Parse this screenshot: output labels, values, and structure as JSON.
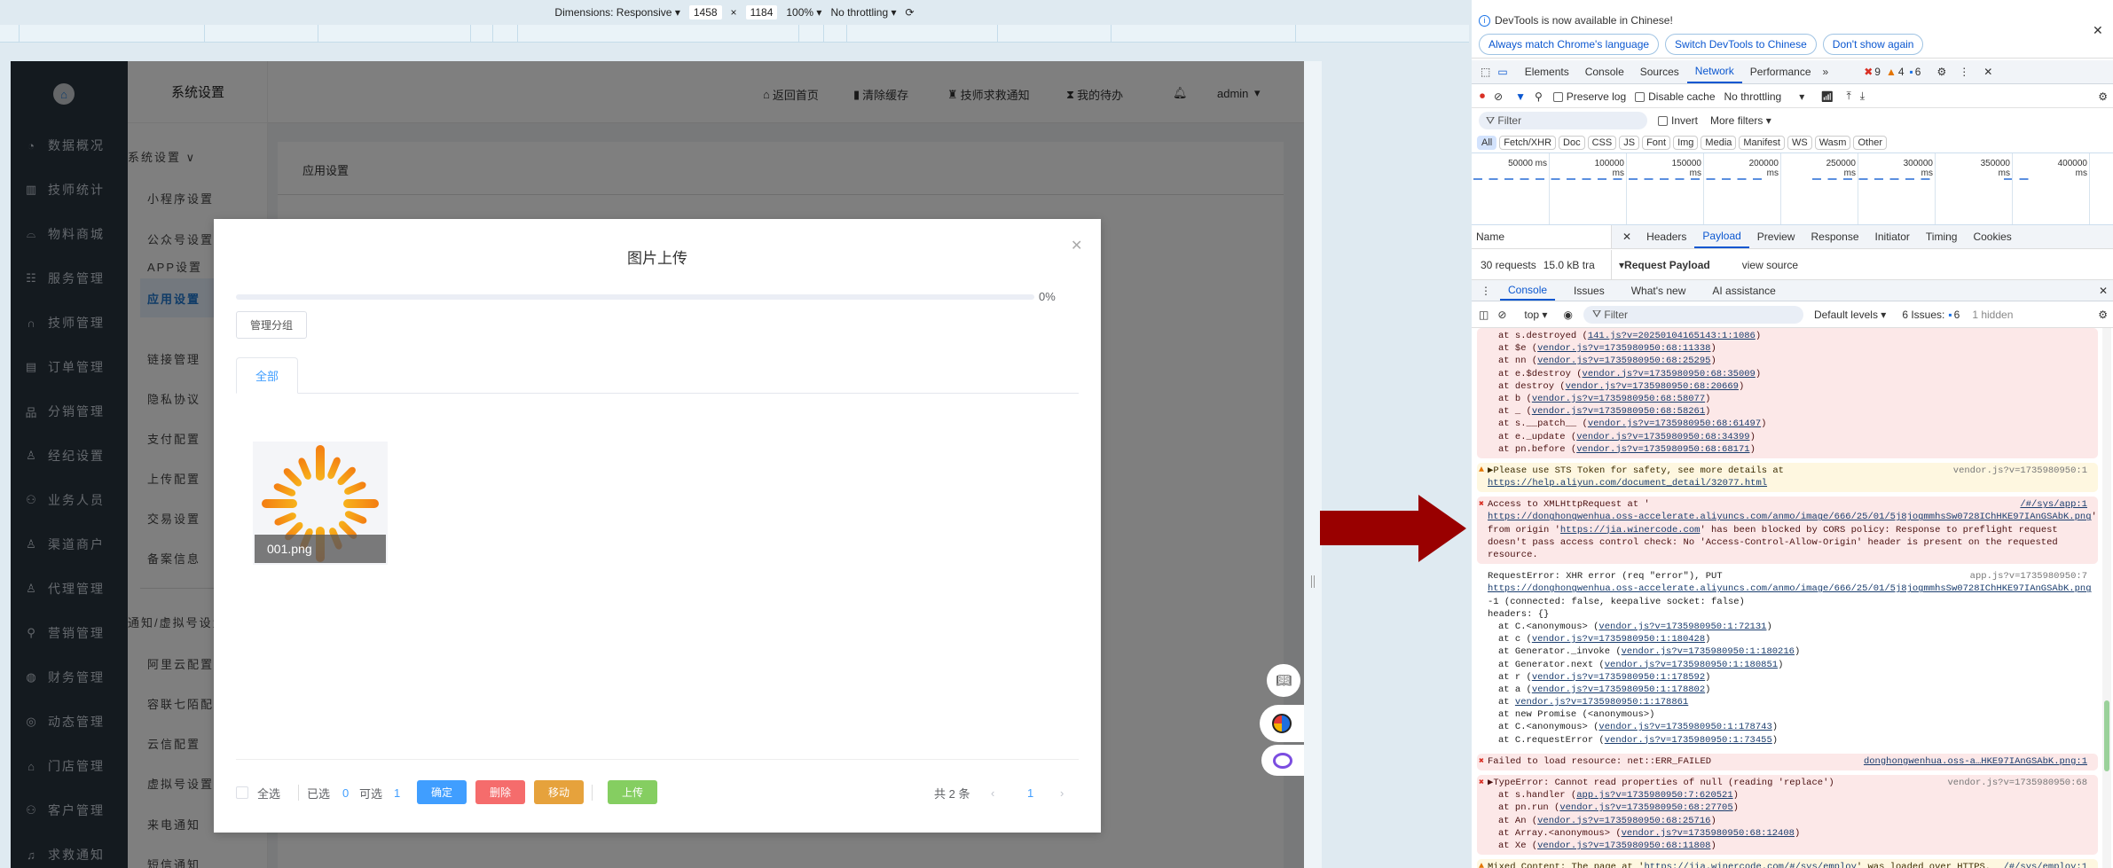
{
  "device_toolbar": {
    "dimensions": "Dimensions: Responsive ▾",
    "width": "1458",
    "x": "×",
    "height": "1184",
    "zoom": "100% ▾",
    "throttle": "No throttling ▾"
  },
  "app": {
    "sidebar": [
      {
        "label": "数据概况",
        "icon": "pie-chart-icon"
      },
      {
        "label": "技师统计",
        "icon": "bar-chart-icon"
      },
      {
        "label": "物料商城",
        "icon": "shop-bag-icon"
      },
      {
        "label": "服务管理",
        "icon": "service-icon"
      },
      {
        "label": "技师管理",
        "icon": "headset-icon"
      },
      {
        "label": "订单管理",
        "icon": "clipboard-icon"
      },
      {
        "label": "分销管理",
        "icon": "org-chart-icon"
      },
      {
        "label": "经纪设置",
        "icon": "user-icon"
      },
      {
        "label": "业务人员",
        "icon": "users-icon"
      },
      {
        "label": "渠道商户",
        "icon": "user-icon"
      },
      {
        "label": "代理管理",
        "icon": "agent-icon"
      },
      {
        "label": "营销管理",
        "icon": "marketing-icon"
      },
      {
        "label": "财务管理",
        "icon": "wallet-icon"
      },
      {
        "label": "动态管理",
        "icon": "compass-icon"
      },
      {
        "label": "门店管理",
        "icon": "store-icon"
      },
      {
        "label": "客户管理",
        "icon": "customers-icon"
      },
      {
        "label": "求救通知",
        "icon": "bell-icon"
      }
    ],
    "submenu_title": "系统设置",
    "submenu": [
      {
        "label": "系统设置 ∨",
        "group": true
      },
      {
        "label": "小程序设置"
      },
      {
        "label": "公众号设置"
      },
      {
        "label": "APP设置"
      },
      {
        "label": "应用设置",
        "active": true
      },
      {
        "label": "链接管理"
      },
      {
        "label": "隐私协议"
      },
      {
        "label": "支付配置"
      },
      {
        "label": "上传配置"
      },
      {
        "label": "交易设置"
      },
      {
        "label": "备案信息"
      },
      {
        "label": "通知/虚拟号设置",
        "group": true
      },
      {
        "label": "阿里云配置"
      },
      {
        "label": "容联七陌配置"
      },
      {
        "label": "云信配置"
      },
      {
        "label": "虚拟号设置"
      },
      {
        "label": "来电通知"
      },
      {
        "label": "短信通知"
      }
    ],
    "header": {
      "home": "返回首页",
      "clear_cache": "清除缓存",
      "sos": "技师求救通知",
      "todo": "我的待办",
      "user": "admin"
    },
    "card_title": "应用设置"
  },
  "modal": {
    "title": "图片上传",
    "progress_percent": 0,
    "progress_label": "0%",
    "manage_group": "管理分组",
    "tab_all": "全部",
    "image_name": "001.png",
    "footer": {
      "select_all": "全选",
      "selected_label": "已选",
      "selected": "0",
      "selectable_label": "可选",
      "selectable": "1",
      "confirm": "确定",
      "delete": "删除",
      "move": "移动",
      "upload": "上传",
      "total": "共 2 条",
      "page": "1"
    },
    "colors": {
      "confirm": "#409eff",
      "delete": "#f56c6c",
      "move": "#e6a23c",
      "upload": "#85ce61"
    }
  },
  "devtools": {
    "banner": {
      "message": "DevTools is now available in Chinese!",
      "btn1": "Always match Chrome's language",
      "btn2": "Switch DevTools to Chinese",
      "btn3": "Don't show again"
    },
    "tabs": [
      "Elements",
      "Console",
      "Sources",
      "Network",
      "Performance"
    ],
    "active_tab": "Network",
    "counts": {
      "errors": "9",
      "warnings": "4",
      "info": "6"
    },
    "network_toolbar": {
      "preserve_log": "Preserve log",
      "disable_cache": "Disable cache",
      "throttle": "No throttling"
    },
    "filter": {
      "placeholder": "Filter",
      "invert": "Invert",
      "more": "More filters ▾"
    },
    "type_filters": [
      "All",
      "Fetch/XHR",
      "Doc",
      "CSS",
      "JS",
      "Font",
      "Img",
      "Media",
      "Manifest",
      "WS",
      "Wasm",
      "Other"
    ],
    "timeline_ticks": [
      "50000 ms",
      "100000 ms",
      "150000 ms",
      "200000 ms",
      "250000 ms",
      "300000 ms",
      "350000 ms",
      "400000 ms"
    ],
    "name_header": "Name",
    "requests": "30 requests",
    "transferred": "15.0 kB tra",
    "detail_tabs": [
      "Headers",
      "Payload",
      "Preview",
      "Response",
      "Initiator",
      "Timing",
      "Cookies"
    ],
    "active_detail": "Payload",
    "payload_title": "▾Request Payload",
    "view_source": "view source",
    "drawer_tabs": [
      "Console",
      "Issues",
      "What's new",
      "AI assistance"
    ],
    "console_toolbar": {
      "context": "top ▾",
      "filter": "Filter",
      "levels": "Default levels ▾",
      "issues": "6 Issues:",
      "issues_count": "6",
      "hidden": "1 hidden"
    },
    "entries": [
      {
        "level": "error",
        "lines": [
          {
            "at": true,
            "t": "at s.destroyed (",
            "l": "141.js?v=20250104165143:1:1086",
            "e": ")"
          },
          {
            "at": true,
            "t": "at $e (",
            "l": "vendor.js?v=1735980950:68:11338",
            "e": ")"
          },
          {
            "at": true,
            "t": "at nn (",
            "l": "vendor.js?v=1735980950:68:25295",
            "e": ")"
          },
          {
            "at": true,
            "t": "at e.$destroy (",
            "l": "vendor.js?v=1735980950:68:35009",
            "e": ")"
          },
          {
            "at": true,
            "t": "at destroy (",
            "l": "vendor.js?v=1735980950:68:20669",
            "e": ")"
          },
          {
            "at": true,
            "t": "at b (",
            "l": "vendor.js?v=1735980950:68:58077",
            "e": ")"
          },
          {
            "at": true,
            "t": "at _ (",
            "l": "vendor.js?v=1735980950:68:58261",
            "e": ")"
          },
          {
            "at": true,
            "t": "at s.__patch__ (",
            "l": "vendor.js?v=1735980950:68:61497",
            "e": ")"
          },
          {
            "at": true,
            "t": "at e._update (",
            "l": "vendor.js?v=1735980950:68:34399",
            "e": ")"
          },
          {
            "at": true,
            "t": "at pn.before (",
            "l": "vendor.js?v=1735980950:68:68171",
            "e": ")"
          }
        ]
      },
      {
        "level": "warn",
        "icon": "▲",
        "src": "vendor.js?v=1735980950:1",
        "lines": [
          {
            "t": "▶Please use STS Token for safety, see more details at"
          },
          {
            "l": "https://help.aliyun.com/document_detail/32077.html"
          }
        ]
      },
      {
        "level": "error",
        "icon": "✖",
        "src": "/#/sys/app:1",
        "src_link": true,
        "lines": [
          {
            "t": "Access to XMLHttpRequest at '"
          },
          {
            "l": "https://donghongwenhua.oss-accelerate.aliyuncs.com/anmo/image/666/25/01/5j8jogmmhsSw0728IChHKE97IAnGSAbK.png",
            "e": "'"
          },
          {
            "t": "from origin '",
            "l": "https://jia.winercode.com",
            "e": "' has been blocked by CORS policy: Response to preflight request"
          },
          {
            "t": "doesn't pass access control check: No 'Access-Control-Allow-Origin' header is present on the requested"
          },
          {
            "t": "resource."
          }
        ]
      },
      {
        "level": "info",
        "src": "app.js?v=1735980950:7",
        "lines": [
          {
            "t": "RequestError: XHR error (req \"error\"), PUT"
          },
          {
            "l": "https://donghongwenhua.oss-accelerate.aliyuncs.com/anmo/image/666/25/01/5j8jogmmhsSw0728IChHKE97IAnGSAbK.png"
          },
          {
            "t": "-1 (connected: false, keepalive socket: false)"
          },
          {
            "t": "headers: {}"
          },
          {
            "at": true,
            "t": "at C.<anonymous> (",
            "l": "vendor.js?v=1735980950:1:72131",
            "e": ")"
          },
          {
            "at": true,
            "t": "at c (",
            "l": "vendor.js?v=1735980950:1:180428",
            "e": ")"
          },
          {
            "at": true,
            "t": "at Generator._invoke (",
            "l": "vendor.js?v=1735980950:1:180216",
            "e": ")"
          },
          {
            "at": true,
            "t": "at Generator.next (",
            "l": "vendor.js?v=1735980950:1:180851",
            "e": ")"
          },
          {
            "at": true,
            "t": "at r (",
            "l": "vendor.js?v=1735980950:1:178592",
            "e": ")"
          },
          {
            "at": true,
            "t": "at a (",
            "l": "vendor.js?v=1735980950:1:178802",
            "e": ")"
          },
          {
            "at": true,
            "t": "at ",
            "l": "vendor.js?v=1735980950:1:178861"
          },
          {
            "at": true,
            "t": "at new Promise (<anonymous>)"
          },
          {
            "at": true,
            "t": "at C.<anonymous> (",
            "l": "vendor.js?v=1735980950:1:178743",
            "e": ")"
          },
          {
            "at": true,
            "t": "at C.requestError (",
            "l": "vendor.js?v=1735980950:1:73455",
            "e": ")"
          }
        ]
      },
      {
        "level": "error",
        "icon": "✖",
        "src": "donghongwenhua.oss-a…HKE97IAnGSAbK.png:1",
        "src_link": true,
        "lines": [
          {
            "t": "Failed to load resource: net::ERR_FAILED"
          }
        ]
      },
      {
        "level": "error",
        "icon": "✖",
        "src": "vendor.js?v=1735980950:68",
        "lines": [
          {
            "t": "▶TypeError: Cannot read properties of null (reading 'replace')"
          },
          {
            "at": true,
            "t": "at s.handler (",
            "l": "app.js?v=1735980950:7:620521",
            "e": ")"
          },
          {
            "at": true,
            "t": "at pn.run (",
            "l": "vendor.js?v=1735980950:68:27705",
            "e": ")"
          },
          {
            "at": true,
            "t": "at An (",
            "l": "vendor.js?v=1735980950:68:25716",
            "e": ")"
          },
          {
            "at": true,
            "t": "at Array.<anonymous> (",
            "l": "vendor.js?v=1735980950:68:12408",
            "e": ")"
          },
          {
            "at": true,
            "t": "at Xe (",
            "l": "vendor.js?v=1735980950:68:11808",
            "e": ")"
          }
        ]
      },
      {
        "level": "warn",
        "icon": "▲",
        "src": "/#/sys/employ:1",
        "src_link": true,
        "lines": [
          {
            "t": "Mixed Content: The page at '",
            "l": "https://jia.winercode.com/#/sys/employ",
            "e": "' was loaded over HTTPS,"
          }
        ]
      }
    ]
  },
  "annotation": {
    "arrow_color": "#990000"
  }
}
